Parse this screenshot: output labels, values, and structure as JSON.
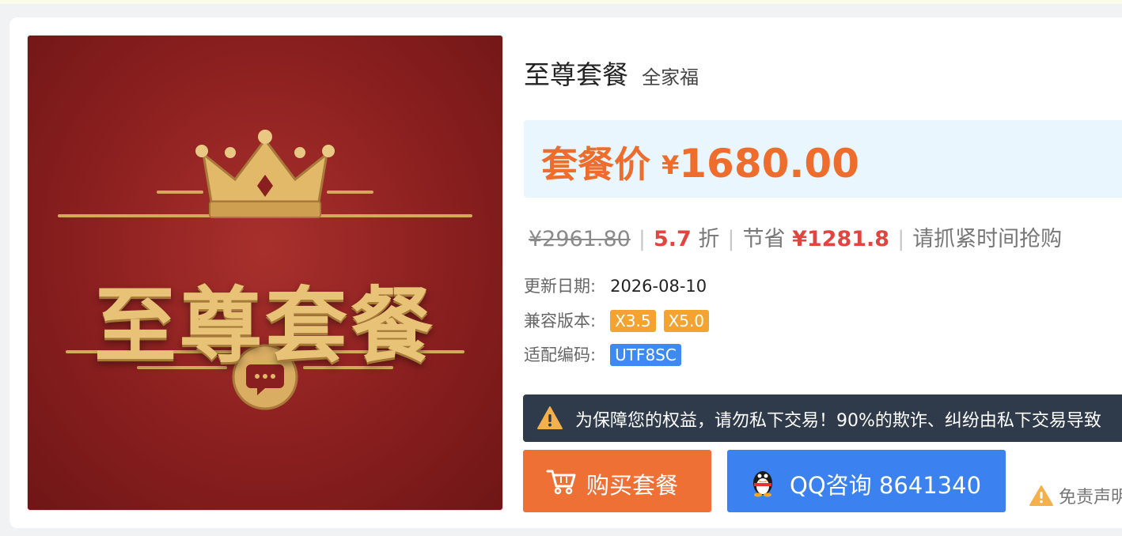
{
  "product": {
    "image_title": "至尊套餐",
    "title": "至尊套餐",
    "subtitle": "全家福"
  },
  "price": {
    "label": "套餐价",
    "currency": "¥",
    "value": "1680.00",
    "original": "¥2961.80",
    "discount_value": "5.7",
    "discount_unit": "折",
    "save_label": "节省",
    "save_value": "¥1281.8",
    "urgency_text": "请抓紧时间抢购"
  },
  "meta": {
    "update_label": "更新日期:",
    "update_value": "2026-08-10",
    "compat_label": "兼容版本:",
    "compat_tags": [
      "X3.5",
      "X5.0"
    ],
    "encoding_label": "适配编码:",
    "encoding_tags": [
      "UTF8SC"
    ]
  },
  "notice": {
    "text": "为保障您的权益，请勿私下交易！90%的欺诈、纠纷由私下交易导致"
  },
  "buttons": {
    "buy_label": "购买套餐",
    "qq_label": "QQ咨询 8641340"
  },
  "disclaimer": {
    "label": "免责声明"
  },
  "colors": {
    "accent_orange": "#ef7034",
    "price_orange": "#ee6d2c",
    "red": "#e0463f",
    "blue": "#3b82f0",
    "notice_bg": "#2f3a4a",
    "tag_orange": "#f4a330"
  },
  "icons": {
    "cart": "cart-icon",
    "qq": "qq-penguin-icon",
    "warning": "warning-icon",
    "crown": "crown-icon",
    "chat": "chat-bubble-icon"
  }
}
